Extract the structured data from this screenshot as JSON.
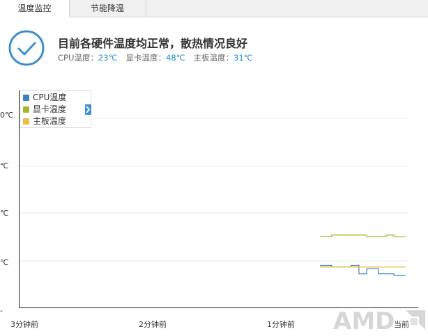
{
  "tabs": [
    {
      "label": "温度监控",
      "active": true
    },
    {
      "label": "节能降温",
      "active": false
    }
  ],
  "status": {
    "title": "目前各硬件温度均正常，散热情况良好",
    "readouts": [
      {
        "label": "CPU温度：",
        "value": "23℃"
      },
      {
        "label": "显卡温度：",
        "value": "48℃"
      },
      {
        "label": "主板温度：",
        "value": "31℃"
      }
    ],
    "icon": "checkmark-circle-icon"
  },
  "legend": {
    "items": [
      {
        "label": "CPU温度",
        "color": "#3b7fc4"
      },
      {
        "label": "显卡温度",
        "color": "#a4b82c"
      },
      {
        "label": "主板温度",
        "color": "#e8be4a"
      }
    ],
    "toggle_icon": "chevron-right-icon"
  },
  "chart_data": {
    "type": "line",
    "y_tick_labels": [
      "0℃",
      "℃",
      "℃",
      "℃",
      "-"
    ],
    "x_tick_labels": [
      "3分钟前",
      "2分钟前",
      "1分钟前",
      "当前"
    ],
    "grid": true,
    "legend_position": "top-left",
    "ylim": [
      0,
      100
    ],
    "series": [
      {
        "name": "CPU温度",
        "color": "#3b7fc4",
        "x": [
          0.78,
          0.8,
          0.81,
          0.85,
          0.86,
          0.87,
          0.88,
          0.89,
          0.9,
          0.91,
          0.93,
          0.97,
          1.0
        ],
        "y": [
          25,
          25,
          24,
          24,
          25,
          25,
          20,
          20,
          23,
          23,
          20,
          19,
          19
        ]
      },
      {
        "name": "显卡温度",
        "color": "#a4b82c",
        "x": [
          0.78,
          0.81,
          0.84,
          0.9,
          0.95,
          0.97,
          1.0
        ],
        "y": [
          42,
          43,
          43,
          42,
          43,
          42,
          42
        ]
      },
      {
        "name": "主板温度",
        "color": "#e8be4a",
        "x": [
          0.78,
          0.85,
          1.0
        ],
        "y": [
          24,
          24,
          24
        ]
      }
    ]
  },
  "watermark": {
    "text": "AMD"
  }
}
